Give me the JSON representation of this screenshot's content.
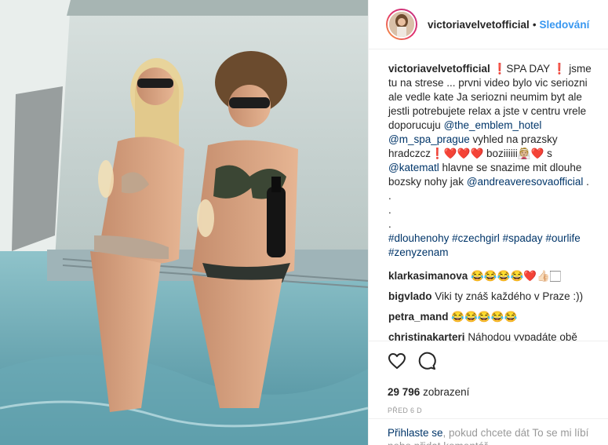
{
  "post": {
    "username": "victoriavelvetofficial",
    "follow_label": "Sledování",
    "header_dot": "•",
    "caption": {
      "username": "victoriavelvetofficial",
      "lines": [
        " ❗SPA DAY ❗ jsme tu na strese ... prvni video bylo vic seriozni ale vedle kate Ja seriozni neumim byt ale jestli potrebujete relax a jste v centru vrele doporucuju ",
        "@the_emblem_hotel",
        "@m_spa_prague",
        " vyhled na prazsky hradczcz❗❤️❤️❤️ boziiiiii👰🏼❤️ s ",
        "@katematl",
        " hlavne se snazime mit dlouhe bozsky nohy jak ",
        "@andreaveresovaofficial",
        " ."
      ],
      "dots": [
        ".",
        ".",
        "."
      ],
      "hashtags": [
        "#dlouhenohy",
        "#czechgirl",
        "#spaday",
        "#ourlife",
        "#zenyzenam"
      ]
    },
    "comments": [
      {
        "user": "klarkasimanova",
        "text": "😂😂😂😂❤️👍🏻🏻"
      },
      {
        "user": "bigvlado",
        "text": "Viki ty znáš každého v Praze :))"
      },
      {
        "user": "petra_mand",
        "text": "😂😂😂😂😂"
      },
      {
        "user": "christinakarteri",
        "text": "Náhodou vypadáte obě"
      }
    ],
    "views_count": "29 796",
    "views_label": "zobrazení",
    "time_ago": "před 6 d",
    "login_link": "Přihlaste se",
    "login_text": ", pokud chcete dát To se mi líbí nebo přidat komentář."
  },
  "icons": {
    "like": "heart-icon",
    "comment": "comment-bubble-icon"
  },
  "colors": {
    "link": "#003569",
    "follow": "#3897f0",
    "muted": "#999999"
  }
}
